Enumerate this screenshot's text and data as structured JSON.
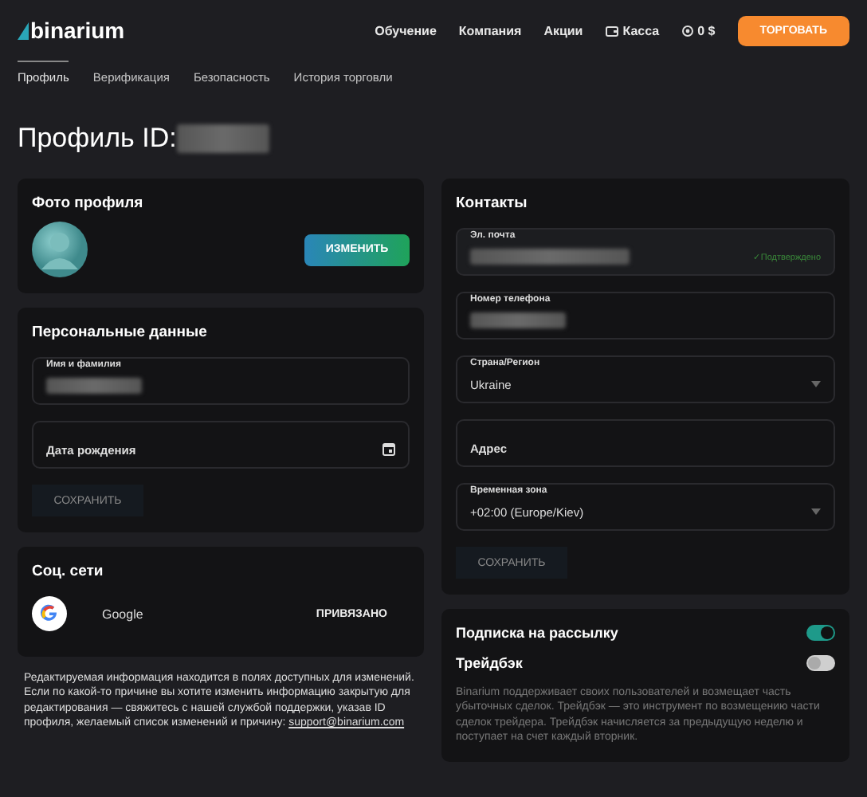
{
  "header": {
    "logo": "binarium",
    "nav": [
      {
        "label": "Обучение",
        "kind": "link"
      },
      {
        "label": "Компания",
        "kind": "link"
      },
      {
        "label": "Акции",
        "kind": "link"
      },
      {
        "label": "Касса",
        "kind": "wallet"
      },
      {
        "label": "0 $",
        "kind": "balance"
      }
    ],
    "cta": "ТОРГОВАТЬ"
  },
  "tabs": [
    {
      "label": "Профиль",
      "selected": true
    },
    {
      "label": "Верификация",
      "selected": false
    },
    {
      "label": "Безопасность",
      "selected": false
    },
    {
      "label": "История торговли",
      "selected": false
    }
  ],
  "page_title": {
    "text": "Профиль ID:",
    "redacted": true
  },
  "photo_card": {
    "title": "Фото профиля",
    "button": "ИЗМЕНИТЬ"
  },
  "personal_card": {
    "title": "Персональные данные",
    "fields": [
      {
        "label": "Имя и фамилия",
        "kind": "text",
        "redacted": true
      },
      {
        "label": "Дата рождения",
        "kind": "date",
        "redacted": false
      }
    ],
    "save": "СОХРАНИТЬ"
  },
  "social_card": {
    "title": "Соц. сети",
    "items": [
      {
        "name": "Google",
        "status": "ПРИВЯЗАНО"
      }
    ]
  },
  "note": {
    "text": "Редактируемая информация находится в полях доступных для изменений. Если по какой-то причине вы хотите изменить информацию закрытую для редактирования — свяжитесь с нашей службой поддержки, указав ID профиля, желаемый список изменений и причину:",
    "link": "support@binarium.com"
  },
  "contacts_card": {
    "title": "Контакты",
    "fields": [
      {
        "label": "Эл. почта",
        "kind": "text",
        "redacted": true,
        "disabled": true,
        "badge": "✓Подтверждено"
      },
      {
        "label": "Номер телефона",
        "kind": "text",
        "redacted": true,
        "disabled": false
      },
      {
        "label": "Страна/Регион",
        "kind": "select",
        "value": "Ukraine",
        "redacted": false,
        "disabled": false
      },
      {
        "label": "Адрес",
        "kind": "text",
        "redacted": false,
        "disabled": false
      },
      {
        "label": "Временная зона",
        "kind": "select",
        "value": "+02:00 (Europe/Kiev)",
        "redacted": false,
        "disabled": false
      }
    ],
    "save": "СОХРАНИТЬ"
  },
  "subscription_card": {
    "toggles": [
      {
        "label": "Подписка на рассылку",
        "on": true
      },
      {
        "label": "Трейдбэк",
        "on": false
      }
    ],
    "description": "Binarium поддерживает своих пользователей и возмещает часть убыточных сделок. Трейдбэк — это инструмент по возмещению части сделок трейдера. Трейдбэк начисляется за предыдущую неделю и поступает на счет каждый вторник."
  }
}
